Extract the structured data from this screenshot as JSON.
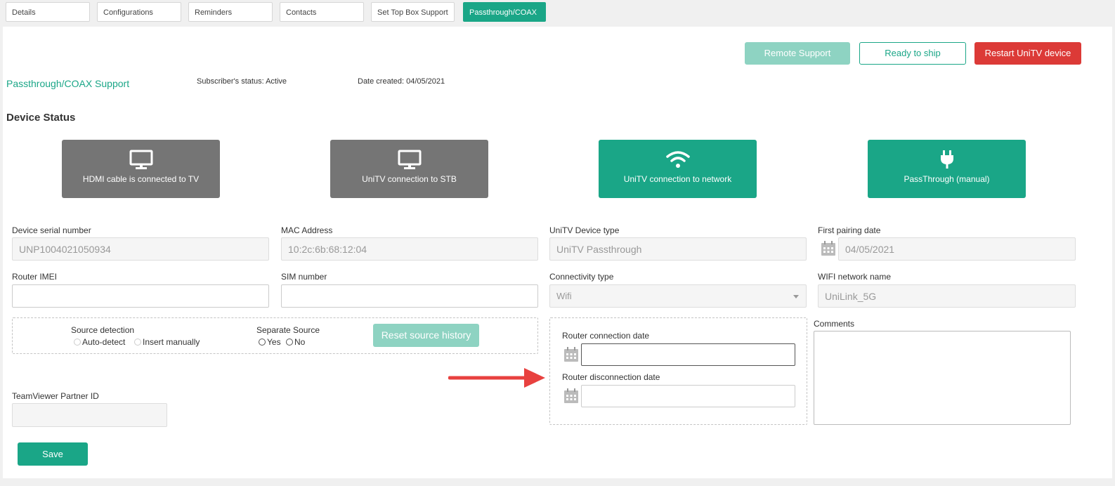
{
  "tabs": [
    {
      "label": "Details"
    },
    {
      "label": "Configurations"
    },
    {
      "label": "Reminders"
    },
    {
      "label": "Contacts"
    },
    {
      "label": "Set Top Box Support"
    },
    {
      "label": "Passthrough/COAX",
      "active": true
    }
  ],
  "actions": {
    "remote_support": "Remote Support",
    "ready_to_ship": "Ready to ship",
    "restart_device": "Restart UniTV device"
  },
  "header": {
    "title": "Passthrough/COAX Support",
    "subscriber_status": "Subscriber's status: Active",
    "date_created": "Date created: 04/05/2021"
  },
  "device_status": {
    "title": "Device Status",
    "tiles": [
      {
        "label": "HDMI cable is connected to TV",
        "icon": "monitor-icon",
        "state": "inactive"
      },
      {
        "label": "UniTV connection to STB",
        "icon": "monitor-icon",
        "state": "inactive"
      },
      {
        "label": "UniTV connection to network",
        "icon": "wifi-icon",
        "state": "active"
      },
      {
        "label": "PassThrough (manual)",
        "icon": "plug-icon",
        "state": "active"
      }
    ]
  },
  "fields": {
    "serial": {
      "label": "Device serial number",
      "value": "UNP1004021050934"
    },
    "mac": {
      "label": "MAC Address",
      "value": "10:2c:6b:68:12:04"
    },
    "device_type": {
      "label": "UniTV Device type",
      "value": "UniTV Passthrough"
    },
    "first_pairing": {
      "label": "First pairing date",
      "value": "04/05/2021"
    },
    "router_imei": {
      "label": "Router IMEI",
      "value": ""
    },
    "sim": {
      "label": "SIM number",
      "value": ""
    },
    "connectivity": {
      "label": "Connectivity type",
      "value": "Wifi"
    },
    "wifi_name": {
      "label": "WIFI network name",
      "value": "UniLink_5G"
    },
    "teamviewer": {
      "label": "TeamViewer Partner ID",
      "value": ""
    },
    "router_conn": {
      "label": "Router connection date",
      "value": ""
    },
    "router_disconn": {
      "label": "Router disconnection date",
      "value": ""
    },
    "comments": {
      "label": "Comments",
      "value": ""
    }
  },
  "source": {
    "detection_label": "Source detection",
    "auto_detect": "Auto-detect",
    "insert_manually": "Insert manually",
    "separate_label": "Separate Source",
    "yes": "Yes",
    "no": "No",
    "reset_button": "Reset source history"
  },
  "save_label": "Save",
  "colors": {
    "accent": "#1aa687",
    "accent_light": "#8ed3c2",
    "danger": "#dc3a37",
    "inactive_tile": "#757575",
    "arrow": "#e8413f"
  }
}
